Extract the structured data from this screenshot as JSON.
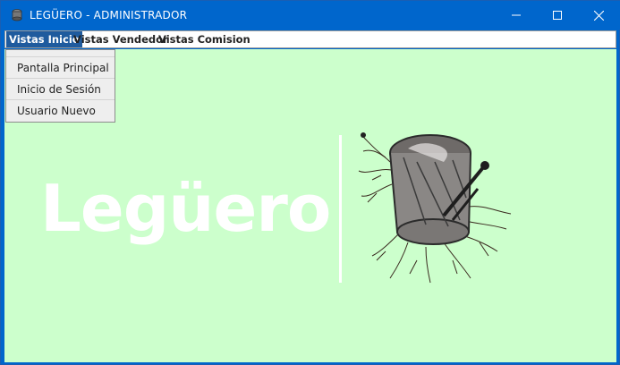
{
  "window": {
    "title": "LEGÜERO - ADMINISTRADOR"
  },
  "menubar": {
    "items": [
      {
        "label": "Vistas Inicio"
      },
      {
        "label": "Vistas Vendedor"
      },
      {
        "label": "Vistas Comision"
      }
    ]
  },
  "dropdown": {
    "items": [
      {
        "label": "Pantalla Principal"
      },
      {
        "label": "Inicio de Sesión"
      },
      {
        "label": "Usuario Nuevo"
      }
    ]
  },
  "main": {
    "brand": "Legüero",
    "logo_icon": "bombo-drum-icon"
  },
  "colors": {
    "titlebar": "#0066cc",
    "content_background": "#ccffcc",
    "menu_active": "#1f5b9e",
    "brand_text": "#ffffff"
  }
}
